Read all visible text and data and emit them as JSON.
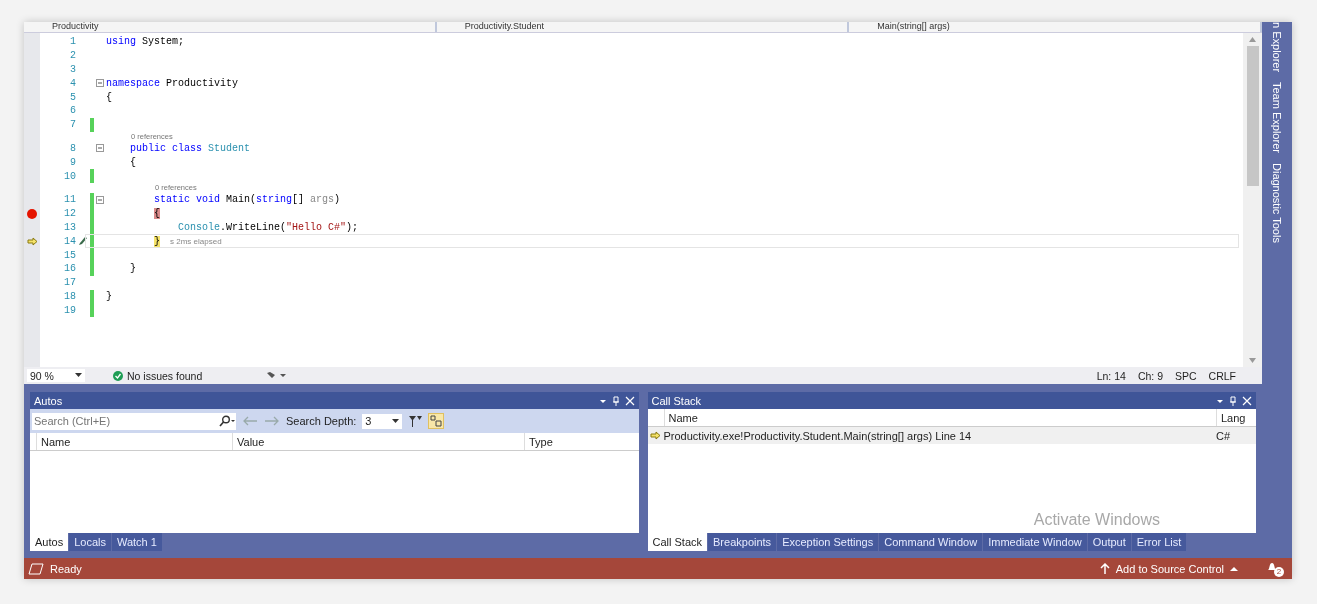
{
  "nav_bar": [
    "Productivity",
    "Productivity.Student",
    "Main(string[] args)"
  ],
  "code_lines": [
    {
      "number": "1",
      "tokens": [
        {
          "text": "using",
          "kind": "keyword"
        },
        {
          "text": " System;",
          "kind": "plain"
        }
      ],
      "changed": false,
      "breakpoint": false,
      "current": false
    },
    {
      "number": "2",
      "changed": false,
      "breakpoint": false,
      "current": false
    },
    {
      "number": "3",
      "changed": false,
      "breakpoint": false,
      "current": false
    },
    {
      "number": "4",
      "fold": true,
      "tokens": [
        {
          "text": "namespace",
          "kind": "keyword"
        },
        {
          "text": " Productivity",
          "kind": "plain"
        }
      ],
      "changed": false,
      "breakpoint": false,
      "current": false
    },
    {
      "number": "5",
      "tokens": [
        {
          "text": "{",
          "kind": "plain"
        }
      ],
      "changed": false,
      "breakpoint": false,
      "current": false
    },
    {
      "number": "6",
      "changed": false,
      "breakpoint": false,
      "current": false
    },
    {
      "number": "7",
      "changed": true,
      "breakpoint": false,
      "current": false
    },
    {
      "number": "8",
      "codelens": "0 references",
      "fold": true,
      "tokens": [
        {
          "text": "    public class",
          "kind": "keyword"
        },
        {
          "text": " Student",
          "kind": "type"
        }
      ],
      "changed": false,
      "breakpoint": false,
      "current": false
    },
    {
      "number": "9",
      "tokens": [
        {
          "text": "    {",
          "kind": "plain"
        }
      ],
      "changed": false,
      "breakpoint": false,
      "current": false
    },
    {
      "number": "10",
      "changed": true,
      "breakpoint": false,
      "current": false
    },
    {
      "number": "11",
      "codelens": "0 references",
      "fold": true,
      "tokens": [
        {
          "text": "        static void",
          "kind": "keyword"
        },
        {
          "text": " Main(",
          "kind": "plain"
        },
        {
          "text": "string",
          "kind": "keyword"
        },
        {
          "text": "[] ",
          "kind": "plain"
        },
        {
          "text": "args",
          "kind": "param"
        },
        {
          "text": ")",
          "kind": "plain"
        }
      ],
      "changed": true,
      "breakpoint": false,
      "current": false
    },
    {
      "number": "12",
      "tokens": [
        {
          "text": "        {",
          "kind": "brace_breakpoint"
        }
      ],
      "changed": true,
      "breakpoint": true,
      "current": false
    },
    {
      "number": "13",
      "tokens": [
        {
          "text": "            Console",
          "kind": "type"
        },
        {
          "text": ".WriteLine(",
          "kind": "plain"
        },
        {
          "text": "\"Hello C#\"",
          "kind": "string"
        },
        {
          "text": ");",
          "kind": "plain"
        }
      ],
      "changed": true,
      "breakpoint": false,
      "current": false
    },
    {
      "number": "14",
      "tokens": [
        {
          "text": "        }",
          "kind": "brace_current"
        }
      ],
      "hint": "s 2ms elapsed",
      "changed": true,
      "breakpoint": false,
      "current": true
    },
    {
      "number": "15",
      "changed": true,
      "breakpoint": false,
      "current": false
    },
    {
      "number": "16",
      "tokens": [
        {
          "text": "    }",
          "kind": "plain"
        }
      ],
      "changed": true,
      "breakpoint": false,
      "current": false
    },
    {
      "number": "17",
      "changed": false,
      "breakpoint": false,
      "current": false
    },
    {
      "number": "18",
      "tokens": [
        {
          "text": "}",
          "kind": "plain"
        }
      ],
      "changed": true,
      "breakpoint": false,
      "current": false
    },
    {
      "number": "19",
      "changed": true,
      "breakpoint": false,
      "current": false
    }
  ],
  "editor_status": {
    "zoom": "90 %",
    "issues": "No issues found",
    "line": "Ln: 14",
    "column": "Ch: 9",
    "indent": "SPC",
    "line_ending": "CRLF"
  },
  "autos": {
    "title": "Autos",
    "search": {
      "placeholder": "Search (Ctrl+E)"
    },
    "depth_label": "Search Depth:",
    "depth_value": "3",
    "columns": [
      "Name",
      "Value",
      "Type"
    ],
    "tabs": [
      {
        "label": "Autos",
        "selected": true
      },
      {
        "label": "Locals",
        "selected": false
      },
      {
        "label": "Watch 1",
        "selected": false
      }
    ]
  },
  "call_stack": {
    "title": "Call Stack",
    "columns": [
      "Name",
      "Lang"
    ],
    "rows": [
      {
        "name": "Productivity.exe!Productivity.Student.Main(string[] args) Line 14",
        "language": "C#",
        "current": true
      }
    ],
    "tabs": [
      {
        "label": "Call Stack",
        "selected": true
      },
      {
        "label": "Breakpoints",
        "selected": false
      },
      {
        "label": "Exception Settings",
        "selected": false
      },
      {
        "label": "Command Window",
        "selected": false
      },
      {
        "label": "Immediate Window",
        "selected": false
      },
      {
        "label": "Output",
        "selected": false
      },
      {
        "label": "Error List",
        "selected": false
      }
    ]
  },
  "overlay_text": "Activate Windows",
  "side_tabs": [
    "n Explorer",
    "Team Explorer",
    "Diagnostic Tools"
  ],
  "status_bar": {
    "state": "Ready",
    "source_control": "Add to Source Control",
    "notifications": "2"
  }
}
